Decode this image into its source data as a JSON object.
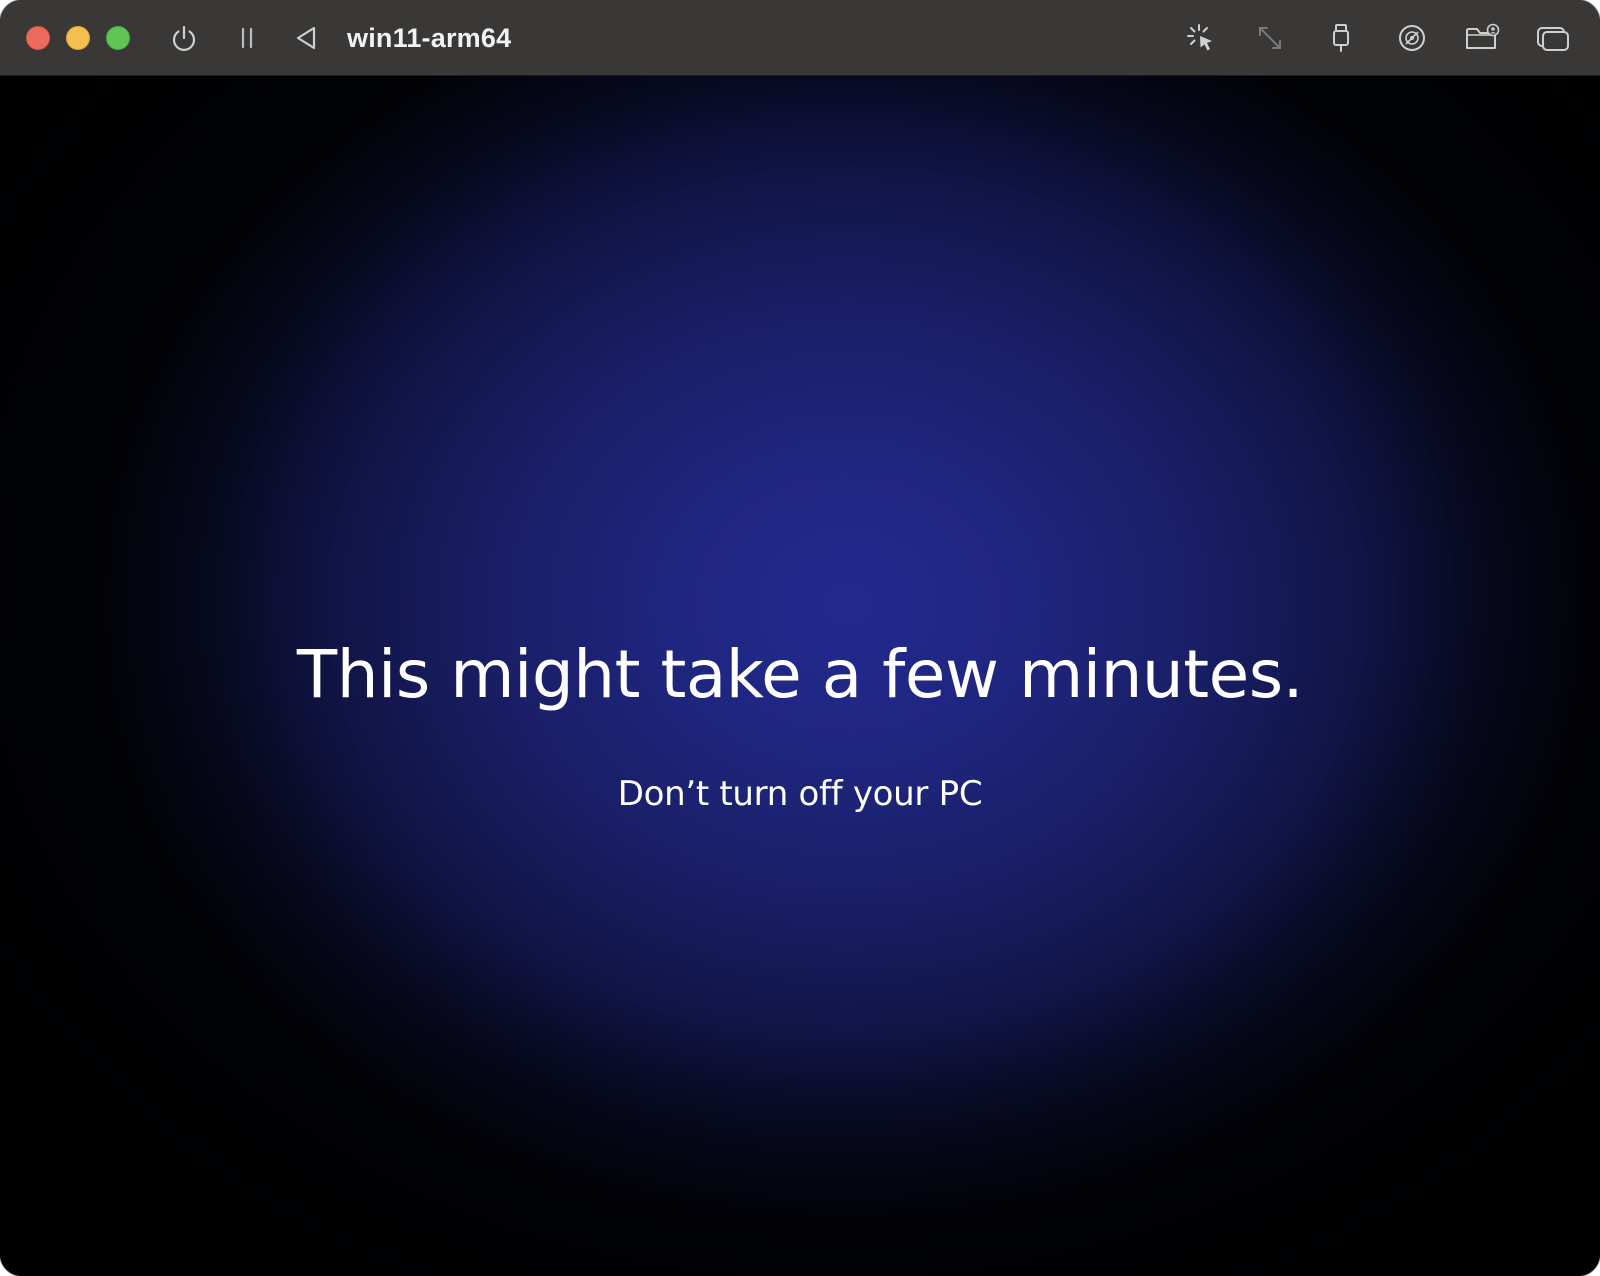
{
  "window": {
    "title": "win11-arm64",
    "titlebar_color": "#3a3836"
  },
  "traffic_lights": {
    "close_color": "#ed6a5e",
    "minimize_color": "#f5bf4f",
    "zoom_color": "#61c554"
  },
  "toolbar": {
    "left_icons": [
      "power-icon",
      "pause-icon",
      "back-triangle-icon"
    ],
    "right_icons": [
      "capture-cursor-icon",
      "resize-arrows-icon",
      "usb-icon",
      "disc-icon",
      "shared-folder-icon",
      "windows-icon"
    ]
  },
  "screen": {
    "headline": "This might take a few minutes.",
    "subtext": "Don’t turn off your PC",
    "background_center_color": "#24298f",
    "background_edge_color": "#000000"
  }
}
